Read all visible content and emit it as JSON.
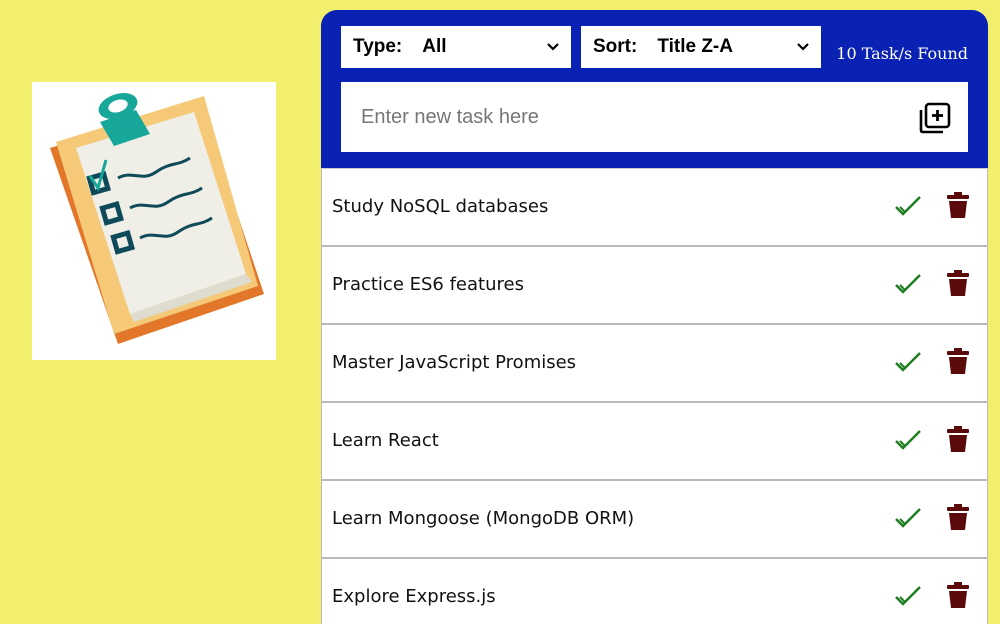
{
  "filters": {
    "type_label": "Type:",
    "type_value": "All",
    "sort_label": "Sort:",
    "sort_value": "Title Z-A"
  },
  "task_count": "10 Task/s Found",
  "new_task": {
    "placeholder": "Enter new task here",
    "add_icon": "plus-square-icon"
  },
  "tasks": [
    {
      "title": "Study NoSQL databases"
    },
    {
      "title": "Practice ES6 features"
    },
    {
      "title": "Master JavaScript Promises"
    },
    {
      "title": "Learn React"
    },
    {
      "title": "Learn Mongoose (MongoDB ORM)"
    },
    {
      "title": "Explore Express.js"
    }
  ],
  "icons": {
    "complete": "check-icon",
    "delete": "trash-icon"
  },
  "colors": {
    "background": "#f2ee6e",
    "header": "#0a22b4",
    "check": "#1e7d1e",
    "trash": "#5a0a0a"
  }
}
